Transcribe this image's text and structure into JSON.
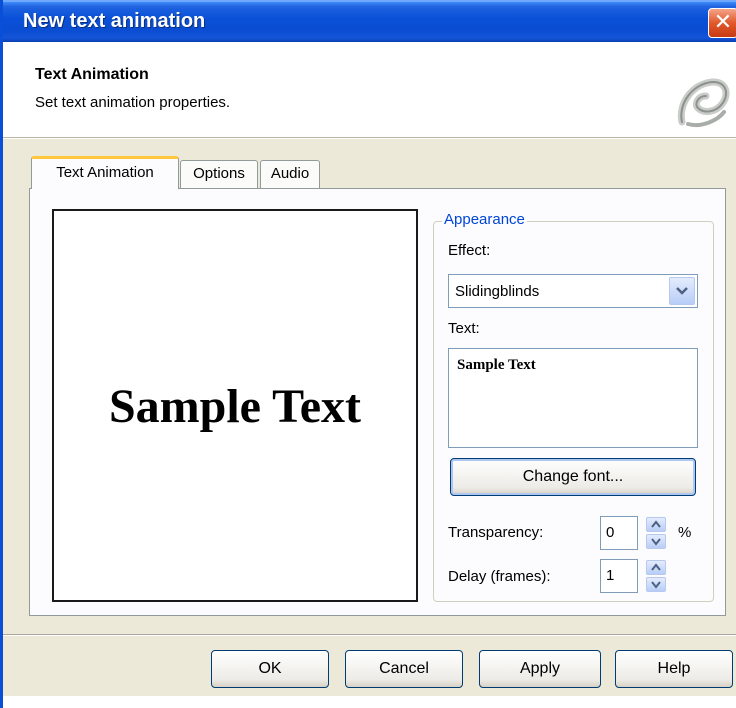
{
  "window": {
    "title": "New text animation",
    "close_icon": "close-icon"
  },
  "header": {
    "title": "Text Animation",
    "subtitle": "Set text animation properties.",
    "logo_icon": "swirl-logo-icon"
  },
  "tabs": [
    {
      "label": "Text Animation",
      "active": true
    },
    {
      "label": "Options",
      "active": false
    },
    {
      "label": "Audio",
      "active": false
    }
  ],
  "preview": {
    "text": "Sample Text"
  },
  "appearance": {
    "group_label": "Appearance",
    "effect_label": "Effect:",
    "effect_value": "Slidingblinds",
    "text_label": "Text:",
    "text_value": "Sample Text",
    "change_font_label": "Change font...",
    "transparency_label": "Transparency:",
    "transparency_value": "0",
    "transparency_unit": "%",
    "delay_label": "Delay (frames):",
    "delay_value": "1"
  },
  "footer": {
    "ok_label": "OK",
    "cancel_label": "Cancel",
    "apply_label": "Apply",
    "help_label": "Help"
  },
  "colors": {
    "titlebar": "#0a51d8",
    "accent_tab": "#ffc83c",
    "group_label": "#0046d5"
  }
}
